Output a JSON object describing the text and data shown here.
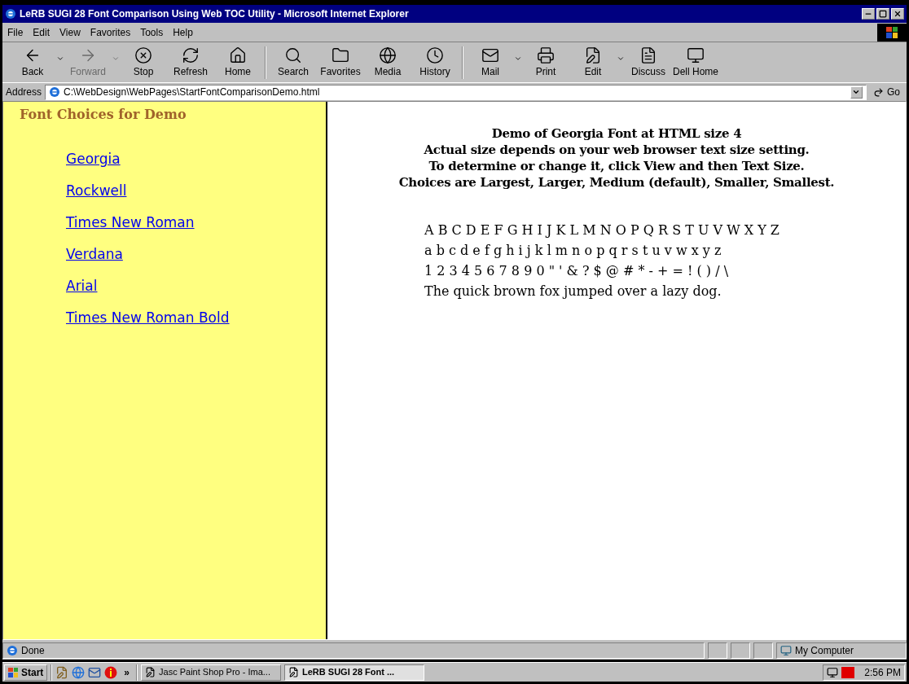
{
  "window": {
    "title": "LeRB SUGI 28 Font Comparison Using Web TOC Utility - Microsoft Internet Explorer"
  },
  "menu": [
    "File",
    "Edit",
    "View",
    "Favorites",
    "Tools",
    "Help"
  ],
  "toolbar": [
    {
      "kind": "button",
      "label": "Back",
      "disabled": false,
      "dropdown": true
    },
    {
      "kind": "button",
      "label": "Forward",
      "disabled": true,
      "dropdown": true
    },
    {
      "kind": "button",
      "label": "Stop",
      "disabled": false,
      "dropdown": false
    },
    {
      "kind": "button",
      "label": "Refresh",
      "disabled": false,
      "dropdown": false
    },
    {
      "kind": "button",
      "label": "Home",
      "disabled": false,
      "dropdown": false
    },
    {
      "kind": "separator"
    },
    {
      "kind": "button",
      "label": "Search",
      "disabled": false,
      "dropdown": false
    },
    {
      "kind": "button",
      "label": "Favorites",
      "disabled": false,
      "dropdown": false
    },
    {
      "kind": "button",
      "label": "Media",
      "disabled": false,
      "dropdown": false
    },
    {
      "kind": "button",
      "label": "History",
      "disabled": false,
      "dropdown": false
    },
    {
      "kind": "separator"
    },
    {
      "kind": "button",
      "label": "Mail",
      "disabled": false,
      "dropdown": true
    },
    {
      "kind": "button",
      "label": "Print",
      "disabled": false,
      "dropdown": false
    },
    {
      "kind": "button",
      "label": "Edit",
      "disabled": false,
      "dropdown": true
    },
    {
      "kind": "button",
      "label": "Discuss",
      "disabled": false,
      "dropdown": false
    },
    {
      "kind": "button",
      "label": "Dell Home",
      "disabled": false,
      "dropdown": false
    }
  ],
  "address": {
    "label": "Address",
    "value": "C:\\WebDesign\\WebPages\\StartFontComparisonDemo.html",
    "go": "Go"
  },
  "sidebar": {
    "title": "Font Choices for Demo",
    "links": [
      "Georgia",
      "Rockwell",
      "Times New Roman",
      "Verdana",
      "Arial",
      "Times New Roman Bold"
    ]
  },
  "main": {
    "heading": [
      "Demo of Georgia Font at HTML size 4",
      "Actual size depends on your web browser text size setting.",
      "To determine or change it, click View and then Text Size.",
      "Choices are Largest, Larger, Medium (default), Smaller, Smallest."
    ],
    "samples": [
      "A B C D E F G H I J K L M N O P Q R S T U V W X Y Z",
      "a b c d e f g h i j k l m n o p q r s t u v w x y z",
      "1 2 3 4 5 6 7 8 9 0 \" ' & ? $ @ # * - + = ! ( ) / \\",
      "The quick brown fox jumped over a lazy dog."
    ]
  },
  "status_bar": {
    "text": "Done",
    "zone": "My Computer"
  },
  "taskbar": {
    "start": "Start",
    "more": "»",
    "tasks": [
      {
        "label": "Jasc Paint Shop Pro - Ima...",
        "selected": false
      },
      {
        "label": "LeRB SUGI 28 Font ...",
        "selected": true
      }
    ],
    "clock": "2:56 PM"
  }
}
